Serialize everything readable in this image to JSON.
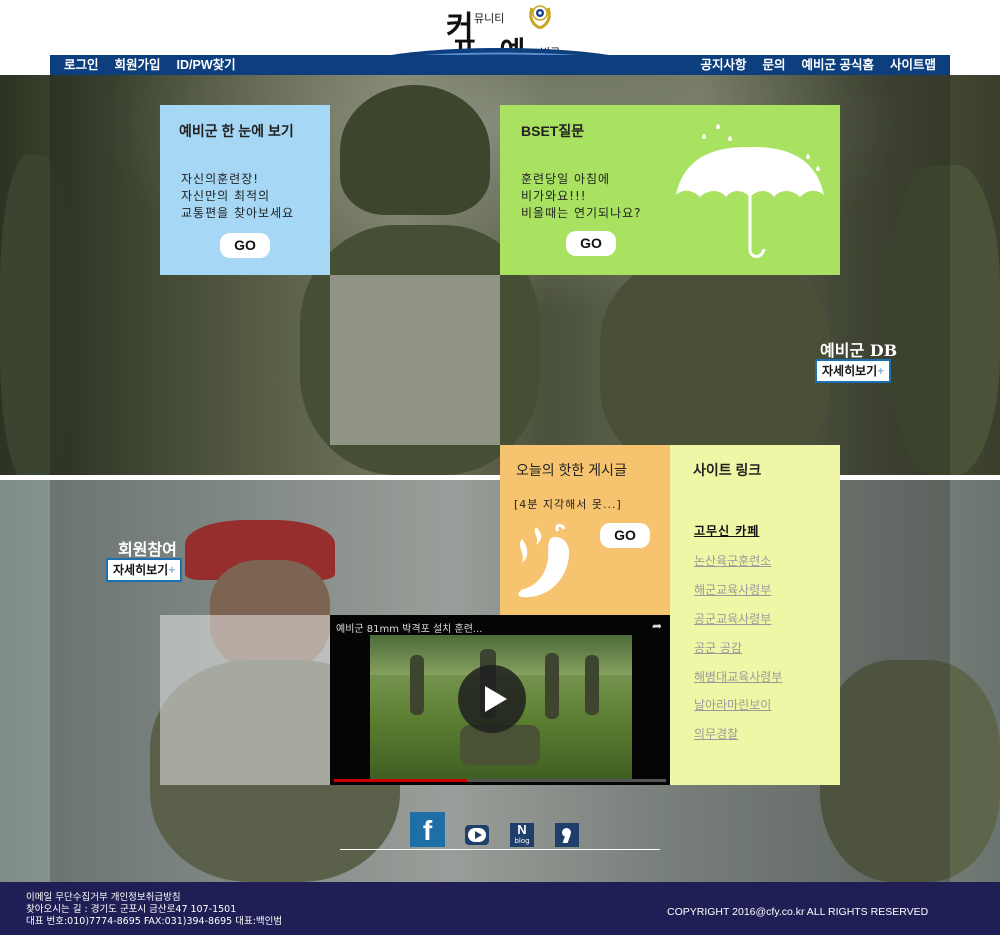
{
  "logo": {
    "char1": "커",
    "sub1": "뮤니티",
    "char2": "포 예",
    "sub2": "비군"
  },
  "nav": {
    "left": [
      "로그인",
      "회원가입",
      "ID/PW찾기"
    ],
    "right": [
      "공지사항",
      "문의",
      "예비군 공식홈",
      "사이트맵"
    ]
  },
  "panels": {
    "overview": {
      "title": "예비군 한 눈에 보기",
      "lines": [
        "자신의훈련장!",
        "자신만의 최적의",
        "교통편을 찾아보세요"
      ],
      "go": "GO"
    },
    "bset": {
      "title": "BSET질문",
      "lines": [
        "훈련당일 아침에",
        "비가와요!!!",
        "비올때는 연기되나요?"
      ],
      "go": "GO"
    },
    "hot": {
      "title": "오늘의 핫한 게시글",
      "post": "[4분 지각해서 못...]",
      "go": "GO"
    },
    "links": {
      "title": "사이트 링크",
      "items": [
        "고무신 카페",
        "논산육군훈련소",
        "해군교육사령부",
        "공군교육사령부",
        "공군 공감",
        "해병대교육사령부",
        "날아라마린보이",
        "의무경찰"
      ]
    }
  },
  "db": {
    "title": "예비군 DB",
    "button": "자세히보기",
    "plus": "+"
  },
  "member": {
    "title": "회원참여",
    "button": "자세히보기",
    "plus": "+"
  },
  "video": {
    "title": "예비군 81mm 박격포 설치 훈련...",
    "progress": 0.4
  },
  "social": {
    "facebook": "f",
    "naver_n": "N",
    "naver_blog": "blog"
  },
  "footer": {
    "line1": "이메일 무단수집거부   개인정보취급방침",
    "line2": "찾아오시는 길 : 경기도 군포시 금산로47 107-1501",
    "line3": "대표 번호:010)7774-8695    FAX:031)394-8695  대표:백인범",
    "copyright": "COPYRIGHT 2016@cfy.co.kr ALL RIGHTS RESERVED"
  },
  "colors": {
    "nav": "#0d3f7e",
    "blue_panel": "#a6d7f5",
    "green_panel": "#a9e261",
    "orange_panel": "#f6c46e",
    "yellow_panel": "#eff7a6",
    "footer": "#1f1f55"
  }
}
